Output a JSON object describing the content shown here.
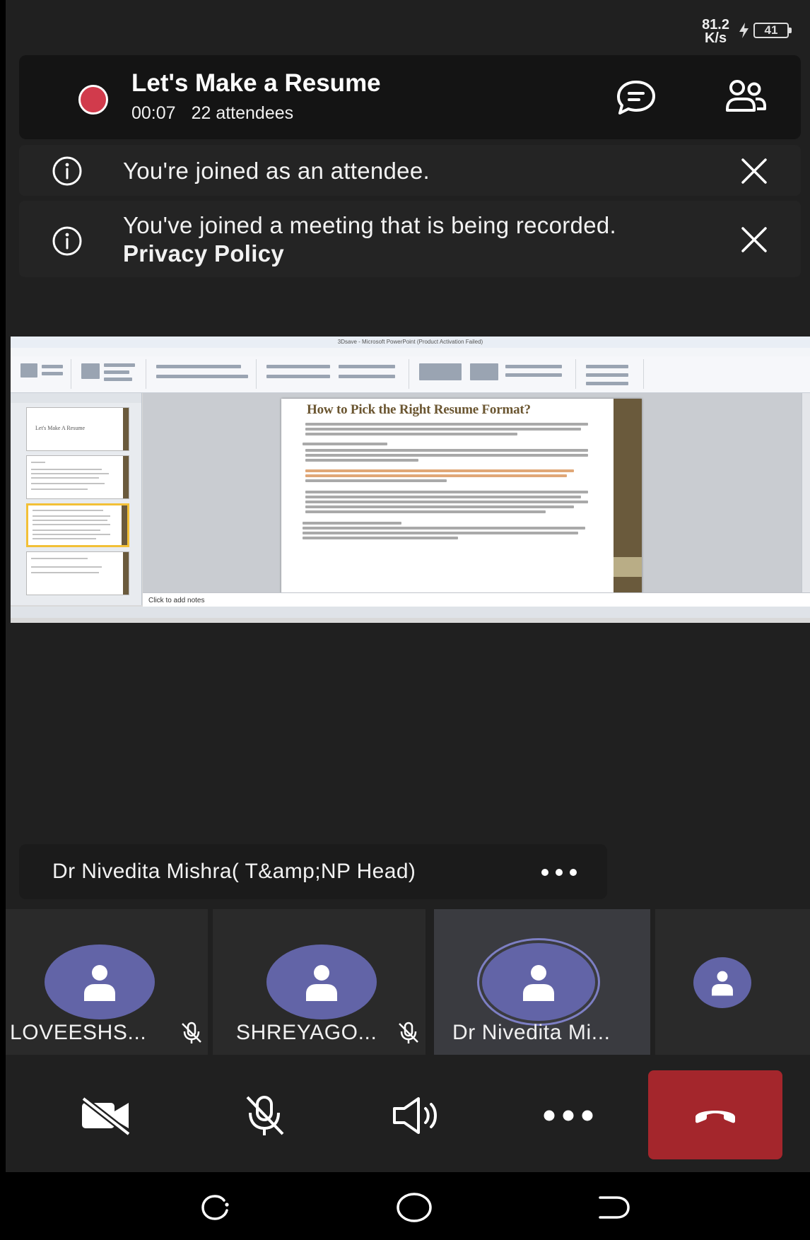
{
  "status_bar": {
    "net_speed_value": "81.2",
    "net_speed_unit": "K/s",
    "battery": "41"
  },
  "meeting": {
    "title": "Let's Make a Resume",
    "elapsed": "00:07",
    "attendees": "22 attendees",
    "recording_dot_color": "#d13b4c",
    "icons": [
      "chat-icon",
      "participants-icon"
    ]
  },
  "notices": [
    {
      "text": "You're joined as an attendee.",
      "icon": "info-icon"
    },
    {
      "text": "You've joined a meeting that is being recorded.",
      "link": "Privacy Policy",
      "icon": "info-icon"
    }
  ],
  "shared_screen": {
    "window_title": "3Dsave - Microsoft PowerPoint (Product Activation Failed)",
    "slide_title": "How to Pick the Right Resume Format?",
    "thumbnail_title": "Let's Make A Resume",
    "notes_placeholder": "Click to add notes"
  },
  "presenter": {
    "name": "Dr Nivedita  Mishra( T&amp;NP Head)",
    "more_icon": "more-icon"
  },
  "participants": [
    {
      "name": "LOVEESHS...",
      "muted": true
    },
    {
      "name": "SHREYAGO...",
      "muted": true
    },
    {
      "name": "Dr Nivedita  Mi...",
      "muted": false,
      "active_speaker": true
    },
    {
      "name": "",
      "muted": false
    }
  ],
  "controls": {
    "icons": [
      "camera-off-icon",
      "mic-off-icon",
      "speaker-icon",
      "more-icon",
      "hang-up-icon"
    ],
    "hangup_color": "#a4262c"
  },
  "accent_color": "#6264a7"
}
